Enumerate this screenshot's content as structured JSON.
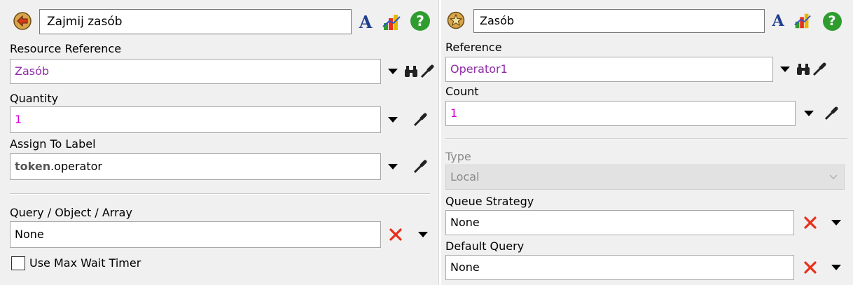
{
  "left": {
    "title": "Zajmij zasób",
    "resource_reference": {
      "label": "Resource Reference",
      "value": "Zasób"
    },
    "quantity": {
      "label": "Quantity",
      "value": "1"
    },
    "assign_to_label": {
      "label": "Assign To Label",
      "token": "token",
      "value": ".operator"
    },
    "query": {
      "label": "Query / Object / Array",
      "value": "None"
    },
    "use_max_wait_timer": {
      "label": "Use Max Wait Timer",
      "checked": false
    }
  },
  "right": {
    "title": "Zasób",
    "reference": {
      "label": "Reference",
      "value": "Operator1"
    },
    "count": {
      "label": "Count",
      "value": "1"
    },
    "type": {
      "label": "Type",
      "value": "Local"
    },
    "queue_strategy": {
      "label": "Queue Strategy",
      "value": "None"
    },
    "default_query": {
      "label": "Default Query",
      "value": "None"
    }
  },
  "icons": {
    "font": "A",
    "help": "?"
  },
  "colors": {
    "purple_text": "#8e2aa8",
    "magenta_text": "#d100d1",
    "delete_x": "#e8301c",
    "help_green": "#2e9d2e",
    "font_blue": "#1f3f8f"
  }
}
